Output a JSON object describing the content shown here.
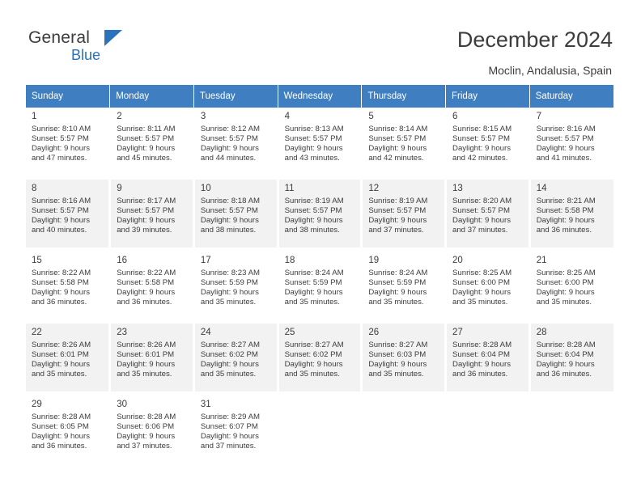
{
  "brand": {
    "general": "General",
    "blue": "Blue",
    "flag_icon": "flag-icon"
  },
  "header": {
    "title": "December 2024",
    "location": "Moclin, Andalusia, Spain"
  },
  "calendar": {
    "weekday_headers": [
      "Sunday",
      "Monday",
      "Tuesday",
      "Wednesday",
      "Thursday",
      "Friday",
      "Saturday"
    ],
    "accent_color": "#3f7fc1",
    "alt_row_color": "#f2f2f2",
    "weeks": [
      [
        {
          "day": "1",
          "lines": [
            "Sunrise: 8:10 AM",
            "Sunset: 5:57 PM",
            "Daylight: 9 hours",
            "and 47 minutes."
          ]
        },
        {
          "day": "2",
          "lines": [
            "Sunrise: 8:11 AM",
            "Sunset: 5:57 PM",
            "Daylight: 9 hours",
            "and 45 minutes."
          ]
        },
        {
          "day": "3",
          "lines": [
            "Sunrise: 8:12 AM",
            "Sunset: 5:57 PM",
            "Daylight: 9 hours",
            "and 44 minutes."
          ]
        },
        {
          "day": "4",
          "lines": [
            "Sunrise: 8:13 AM",
            "Sunset: 5:57 PM",
            "Daylight: 9 hours",
            "and 43 minutes."
          ]
        },
        {
          "day": "5",
          "lines": [
            "Sunrise: 8:14 AM",
            "Sunset: 5:57 PM",
            "Daylight: 9 hours",
            "and 42 minutes."
          ]
        },
        {
          "day": "6",
          "lines": [
            "Sunrise: 8:15 AM",
            "Sunset: 5:57 PM",
            "Daylight: 9 hours",
            "and 42 minutes."
          ]
        },
        {
          "day": "7",
          "lines": [
            "Sunrise: 8:16 AM",
            "Sunset: 5:57 PM",
            "Daylight: 9 hours",
            "and 41 minutes."
          ]
        }
      ],
      [
        {
          "day": "8",
          "lines": [
            "Sunrise: 8:16 AM",
            "Sunset: 5:57 PM",
            "Daylight: 9 hours",
            "and 40 minutes."
          ]
        },
        {
          "day": "9",
          "lines": [
            "Sunrise: 8:17 AM",
            "Sunset: 5:57 PM",
            "Daylight: 9 hours",
            "and 39 minutes."
          ]
        },
        {
          "day": "10",
          "lines": [
            "Sunrise: 8:18 AM",
            "Sunset: 5:57 PM",
            "Daylight: 9 hours",
            "and 38 minutes."
          ]
        },
        {
          "day": "11",
          "lines": [
            "Sunrise: 8:19 AM",
            "Sunset: 5:57 PM",
            "Daylight: 9 hours",
            "and 38 minutes."
          ]
        },
        {
          "day": "12",
          "lines": [
            "Sunrise: 8:19 AM",
            "Sunset: 5:57 PM",
            "Daylight: 9 hours",
            "and 37 minutes."
          ]
        },
        {
          "day": "13",
          "lines": [
            "Sunrise: 8:20 AM",
            "Sunset: 5:57 PM",
            "Daylight: 9 hours",
            "and 37 minutes."
          ]
        },
        {
          "day": "14",
          "lines": [
            "Sunrise: 8:21 AM",
            "Sunset: 5:58 PM",
            "Daylight: 9 hours",
            "and 36 minutes."
          ]
        }
      ],
      [
        {
          "day": "15",
          "lines": [
            "Sunrise: 8:22 AM",
            "Sunset: 5:58 PM",
            "Daylight: 9 hours",
            "and 36 minutes."
          ]
        },
        {
          "day": "16",
          "lines": [
            "Sunrise: 8:22 AM",
            "Sunset: 5:58 PM",
            "Daylight: 9 hours",
            "and 36 minutes."
          ]
        },
        {
          "day": "17",
          "lines": [
            "Sunrise: 8:23 AM",
            "Sunset: 5:59 PM",
            "Daylight: 9 hours",
            "and 35 minutes."
          ]
        },
        {
          "day": "18",
          "lines": [
            "Sunrise: 8:24 AM",
            "Sunset: 5:59 PM",
            "Daylight: 9 hours",
            "and 35 minutes."
          ]
        },
        {
          "day": "19",
          "lines": [
            "Sunrise: 8:24 AM",
            "Sunset: 5:59 PM",
            "Daylight: 9 hours",
            "and 35 minutes."
          ]
        },
        {
          "day": "20",
          "lines": [
            "Sunrise: 8:25 AM",
            "Sunset: 6:00 PM",
            "Daylight: 9 hours",
            "and 35 minutes."
          ]
        },
        {
          "day": "21",
          "lines": [
            "Sunrise: 8:25 AM",
            "Sunset: 6:00 PM",
            "Daylight: 9 hours",
            "and 35 minutes."
          ]
        }
      ],
      [
        {
          "day": "22",
          "lines": [
            "Sunrise: 8:26 AM",
            "Sunset: 6:01 PM",
            "Daylight: 9 hours",
            "and 35 minutes."
          ]
        },
        {
          "day": "23",
          "lines": [
            "Sunrise: 8:26 AM",
            "Sunset: 6:01 PM",
            "Daylight: 9 hours",
            "and 35 minutes."
          ]
        },
        {
          "day": "24",
          "lines": [
            "Sunrise: 8:27 AM",
            "Sunset: 6:02 PM",
            "Daylight: 9 hours",
            "and 35 minutes."
          ]
        },
        {
          "day": "25",
          "lines": [
            "Sunrise: 8:27 AM",
            "Sunset: 6:02 PM",
            "Daylight: 9 hours",
            "and 35 minutes."
          ]
        },
        {
          "day": "26",
          "lines": [
            "Sunrise: 8:27 AM",
            "Sunset: 6:03 PM",
            "Daylight: 9 hours",
            "and 35 minutes."
          ]
        },
        {
          "day": "27",
          "lines": [
            "Sunrise: 8:28 AM",
            "Sunset: 6:04 PM",
            "Daylight: 9 hours",
            "and 36 minutes."
          ]
        },
        {
          "day": "28",
          "lines": [
            "Sunrise: 8:28 AM",
            "Sunset: 6:04 PM",
            "Daylight: 9 hours",
            "and 36 minutes."
          ]
        }
      ],
      [
        {
          "day": "29",
          "lines": [
            "Sunrise: 8:28 AM",
            "Sunset: 6:05 PM",
            "Daylight: 9 hours",
            "and 36 minutes."
          ]
        },
        {
          "day": "30",
          "lines": [
            "Sunrise: 8:28 AM",
            "Sunset: 6:06 PM",
            "Daylight: 9 hours",
            "and 37 minutes."
          ]
        },
        {
          "day": "31",
          "lines": [
            "Sunrise: 8:29 AM",
            "Sunset: 6:07 PM",
            "Daylight: 9 hours",
            "and 37 minutes."
          ]
        },
        {
          "day": "",
          "lines": []
        },
        {
          "day": "",
          "lines": []
        },
        {
          "day": "",
          "lines": []
        },
        {
          "day": "",
          "lines": []
        }
      ]
    ]
  }
}
